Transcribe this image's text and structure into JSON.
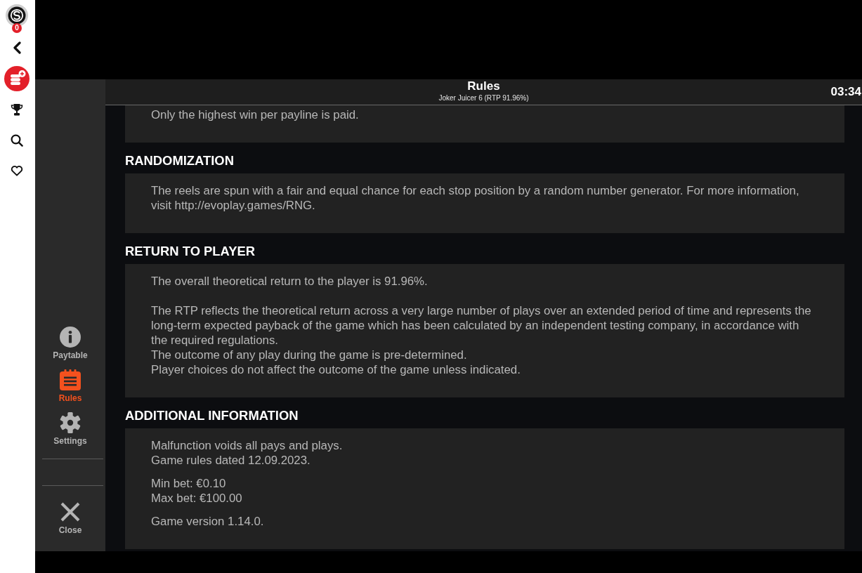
{
  "sidebar": {
    "badge": "0"
  },
  "header": {
    "title": "Rules",
    "subtitle": "Joker Juicer 6 (RTP 91.96%)",
    "clock": "03:34"
  },
  "menu": {
    "tabs": [
      {
        "label": "Paytable",
        "selected": false
      },
      {
        "label": "Rules",
        "selected": true
      },
      {
        "label": "Settings",
        "selected": false
      }
    ],
    "close": {
      "label": "Close"
    }
  },
  "sections": [
    {
      "blocks": [
        [
          "Only the highest win per payline is paid."
        ]
      ]
    },
    {
      "heading": "RANDOMIZATION",
      "blocks": [
        [
          "The reels are spun with a fair and equal chance for each stop position by a random number generator. For more information, visit http://evoplay.games/RNG."
        ]
      ]
    },
    {
      "heading": "RETURN TO PLAYER",
      "blocks": [
        [
          "The overall theoretical return to the player is 91.96%."
        ],
        [
          "The RTP reflects the theoretical return across a very large number of plays over an extended period of time and represents the long-term expected payback of the game which has been calculated by an independent testing company, in accordance with the required regulations.",
          "The outcome of any play during the game is pre-determined.",
          "Player choices do not affect the outcome of the game unless indicated."
        ]
      ]
    },
    {
      "heading": "ADDITIONAL INFORMATION",
      "blocks": [
        [
          "Malfunction voids all pays and plays.",
          "Game rules dated 12.09.2023."
        ],
        [
          "Min bet: €0.10",
          "Max bet: €100.00"
        ],
        [
          "Game version 1.14.0."
        ]
      ]
    }
  ]
}
